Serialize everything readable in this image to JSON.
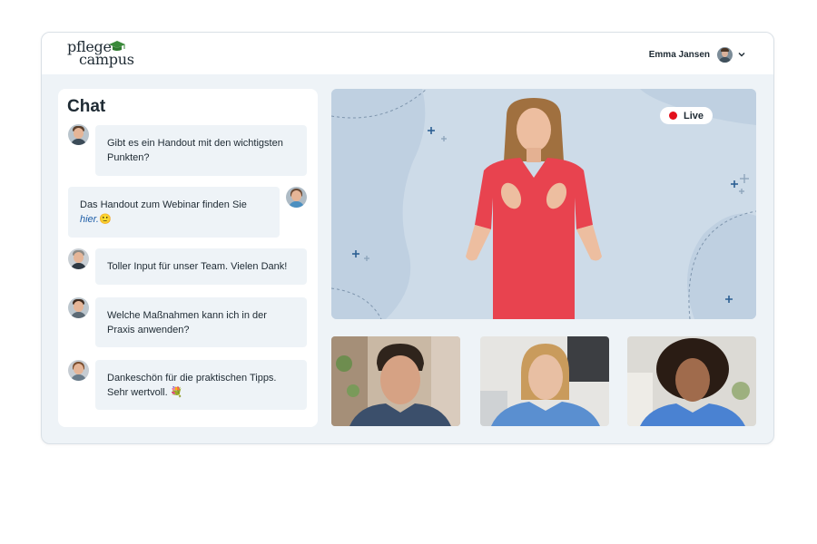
{
  "app": {
    "logo_line1": "pflege",
    "logo_line2": "campus",
    "brand_color": "#3a8a3a"
  },
  "user": {
    "name": "Emma Jansen",
    "avatar_icon": "user-avatar",
    "menu_icon": "chevron-down-icon"
  },
  "chat": {
    "title": "Chat",
    "messages": [
      {
        "side": "left",
        "text": "Gibt es ein Handout mit den wichtigsten Punkten?"
      },
      {
        "side": "right",
        "text": "Das Handout zum Webinar finden Sie",
        "link": "hier.",
        "emoji": "🙂"
      },
      {
        "side": "left",
        "text": "Toller Input für unser Team. Vielen Dank!"
      },
      {
        "side": "left",
        "text": "Welche Maßnahmen kann ich in der Praxis anwenden?"
      },
      {
        "side": "left",
        "text": "Dankeschön für die praktischen Tipps. Sehr wertvoll.",
        "emoji": "💐"
      }
    ]
  },
  "stage": {
    "live_label": "Live",
    "live_color": "#e3101c",
    "presenter_shirt_color": "#e8434f"
  },
  "colors": {
    "window_bg": "#eef3f7",
    "bubble_bg": "#eef3f7",
    "stage_bg": "#cddbe8",
    "link": "#1f5fa8"
  }
}
